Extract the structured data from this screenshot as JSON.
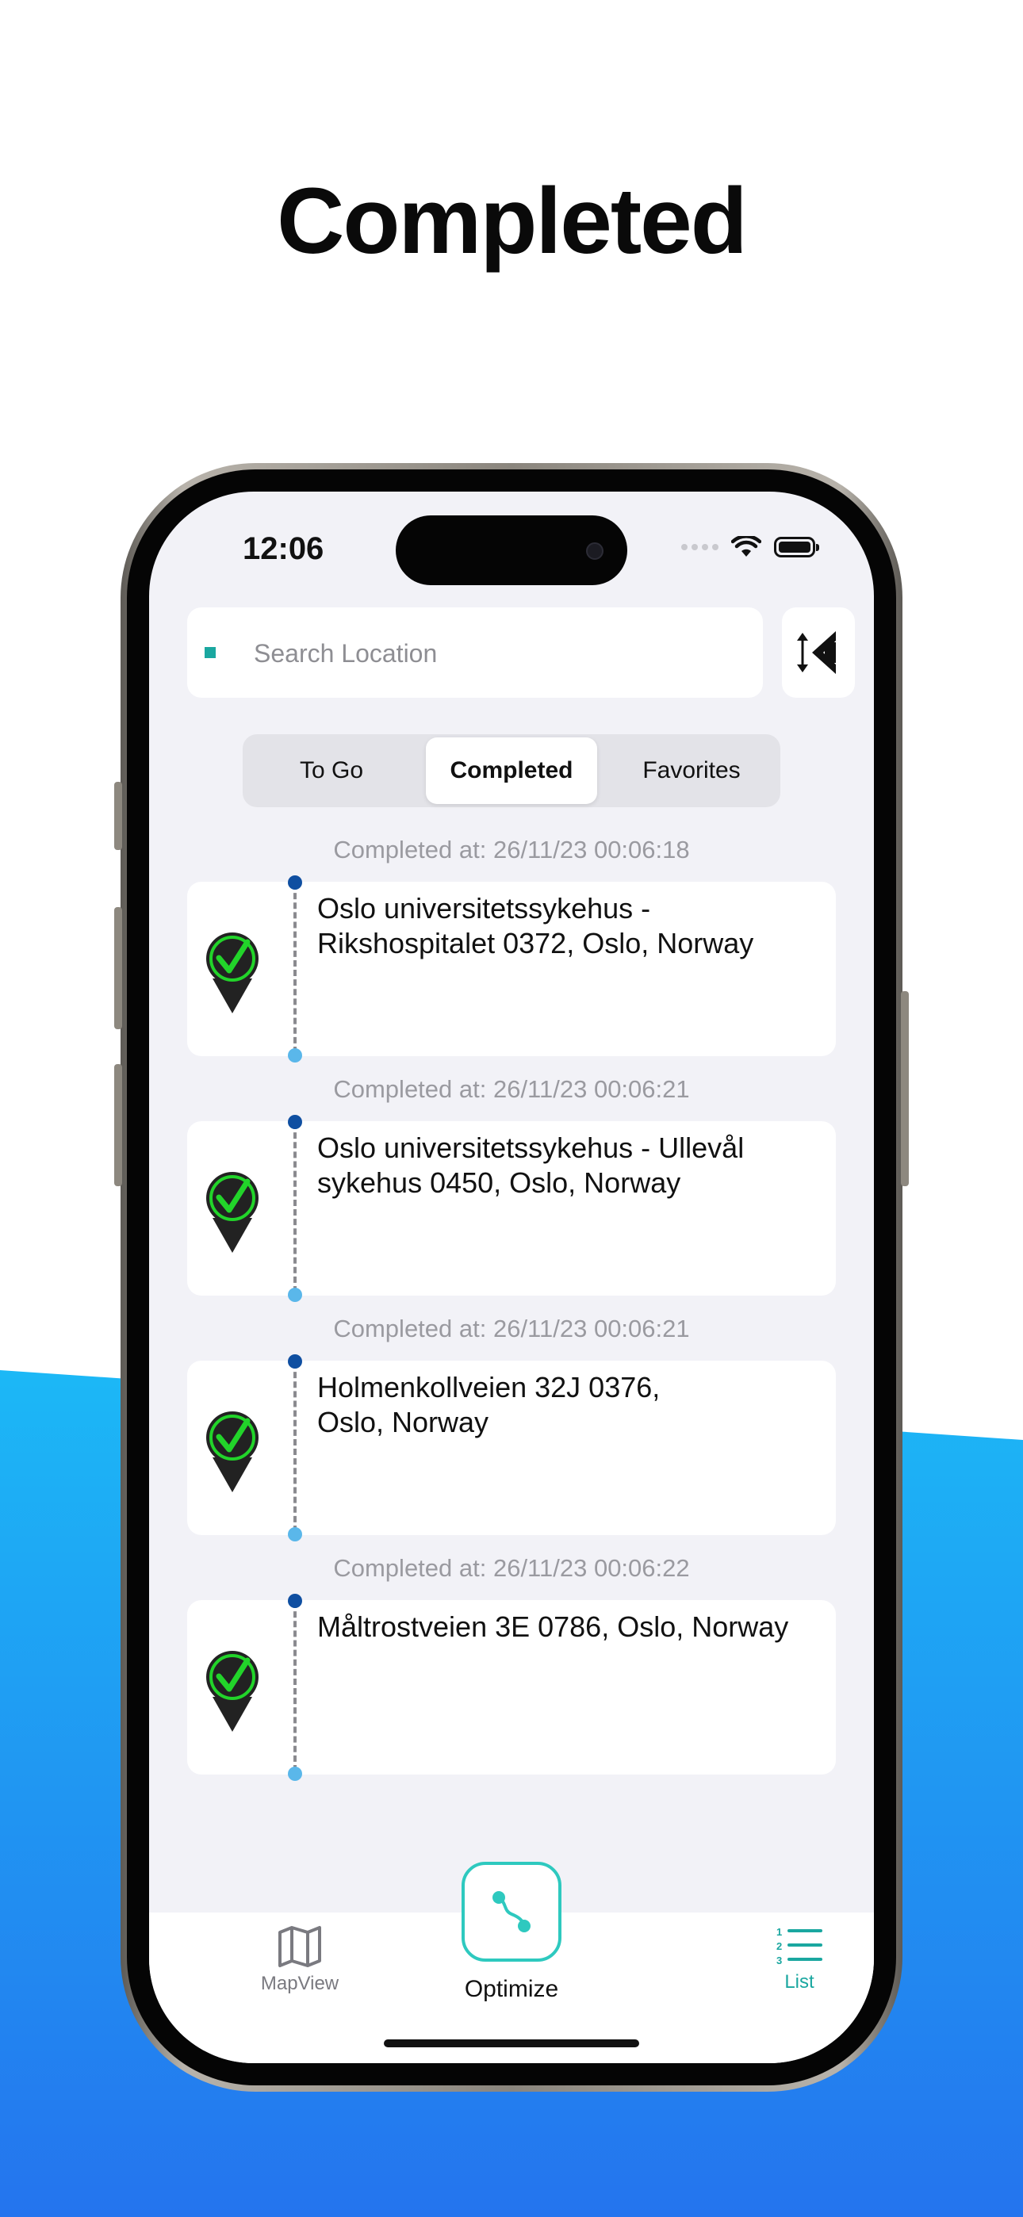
{
  "headline": "Completed",
  "status_bar": {
    "time": "12:06"
  },
  "search": {
    "placeholder": "Search Location",
    "value": ""
  },
  "segments": [
    {
      "label": "To Go",
      "active": false
    },
    {
      "label": "Completed",
      "active": true
    },
    {
      "label": "Favorites",
      "active": false
    }
  ],
  "entries": [
    {
      "completed_at": "Completed at: 26/11/23 00:06:18",
      "address": "Oslo universitetssykehus -\nRikshospitalet 0372, Oslo, Norway"
    },
    {
      "completed_at": "Completed at: 26/11/23 00:06:21",
      "address": "Oslo universitetssykehus - Ullevål\nsykehus 0450, Oslo, Norway"
    },
    {
      "completed_at": "Completed at: 26/11/23 00:06:21",
      "address": "Holmenkollveien 32J 0376,\nOslo, Norway"
    },
    {
      "completed_at": "Completed at: 26/11/23 00:06:22",
      "address": "Måltrostveien 3E 0786, Oslo, Norway"
    }
  ],
  "tabbar": {
    "mapview_label": "MapView",
    "optimize_label": "Optimize",
    "list_label": "List"
  },
  "colors": {
    "accent": "#1aa7a0",
    "optimize_border": "#2ec9bf",
    "pin_check": "#22d42a",
    "route_top": "#0f4fa1",
    "route_bottom": "#5ab7ea",
    "background_blue_top": "#1cb8f6",
    "background_blue_bottom": "#2474ee"
  },
  "icons": {
    "sort": "sort-arrows-icon",
    "mapview": "map-icon",
    "optimize": "route-icon",
    "list": "numbered-list-icon",
    "pin": "check-pin-icon"
  }
}
